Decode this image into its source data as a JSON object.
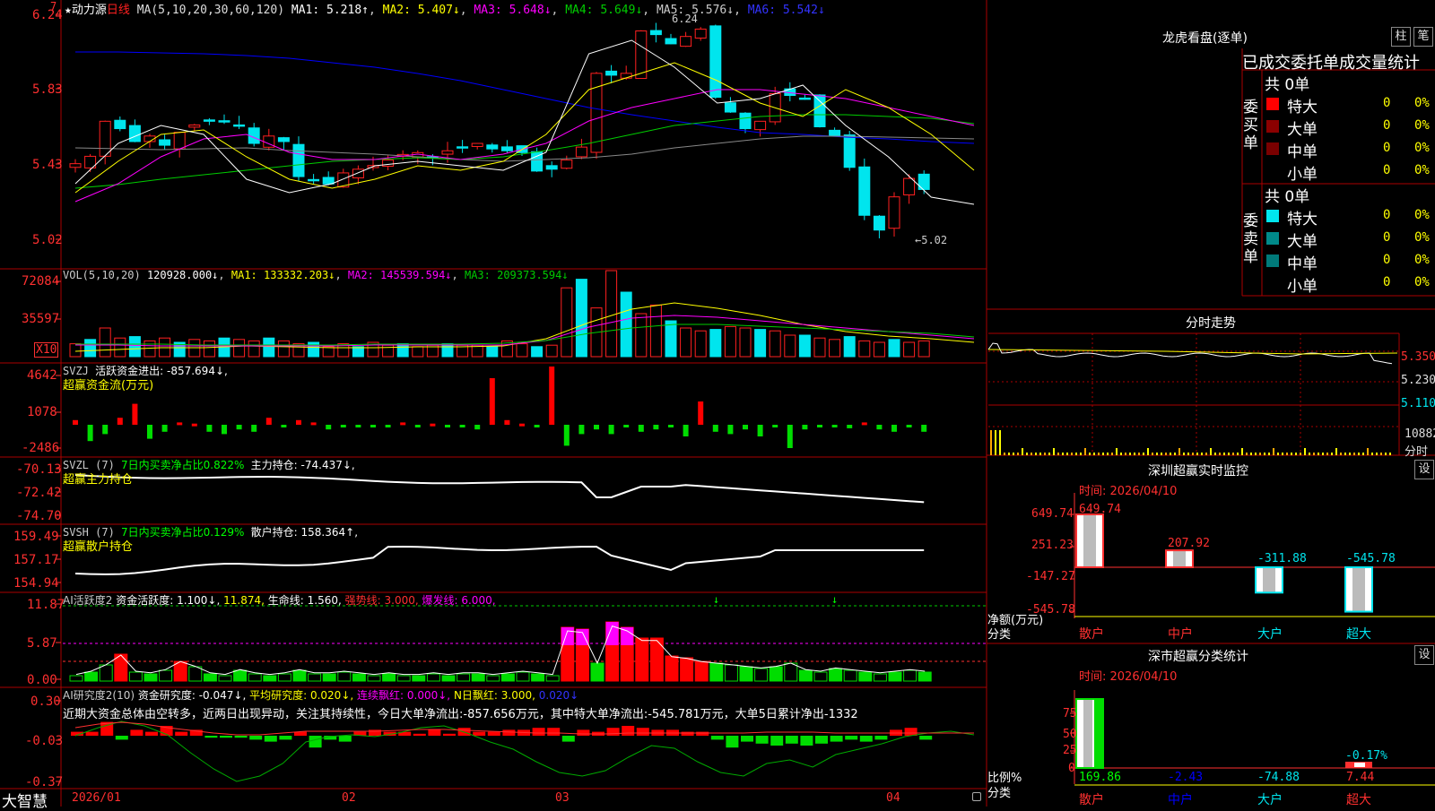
{
  "colors": {
    "up": "#ff2020",
    "down": "#00e5ee",
    "ma1": "#ffffff",
    "ma2": "#ffff00",
    "ma3": "#ff00ff",
    "ma4": "#00cc00",
    "ma5": "#888888",
    "ma6": "#0000ff",
    "grid": "#aa0000",
    "axis": "#ff3030"
  },
  "kline": {
    "star": "★",
    "name": "动力源",
    "period": "日线",
    "ma_label": "MA(5,10,20,30,60,120)",
    "ma": [
      {
        "label": "MA1:",
        "value": "5.218↑"
      },
      {
        "label": "MA2:",
        "value": "5.407↓"
      },
      {
        "label": "MA3:",
        "value": "5.648↓"
      },
      {
        "label": "MA4:",
        "value": "5.649↓"
      },
      {
        "label": "MA5:",
        "value": "5.576↓"
      },
      {
        "label": "MA6:",
        "value": "5.542↓"
      }
    ],
    "y_ticks": [
      "6.24",
      "5.83",
      "5.43",
      "5.02"
    ],
    "high_marker": "6.24",
    "low_marker": "←5.02",
    "top_left": "7"
  },
  "vol": {
    "title": "VOL(5,10,20)",
    "value": "120928.000↓",
    "ma1": "MA1: 133332.203↓",
    "ma2": "MA2: 145539.594↓",
    "ma3": "MA3: 209373.594↓",
    "y_ticks": [
      "72084",
      "35597"
    ],
    "unit": "X10"
  },
  "svzj": {
    "title": "SVZJ",
    "label": "活跃资金进出: -857.694↓,",
    "sub": "超赢资金流(万元)",
    "y_ticks": [
      "4642",
      "1078",
      "-2486"
    ]
  },
  "svzl": {
    "title": "SVZL (7)",
    "label1": "7日内买卖净占比0.822%",
    "label2": "主力持仓: -74.437↓,",
    "sub": "超赢主力持仓",
    "y_ticks": [
      "-70.13",
      "-72.42",
      "-74.70"
    ]
  },
  "svsh": {
    "title": "SVSH (7)",
    "label1": "7日内买卖净占比0.129%",
    "label2": "散户持仓: 158.364↑,",
    "sub": "超赢散户持仓",
    "y_ticks": [
      "159.49",
      "157.17",
      "154.94"
    ]
  },
  "ai1": {
    "title": "AI活跃度2",
    "l1": "资金活跃度: 1.100↓,",
    "l2": "11.874,",
    "l3": "生命线: 1.560,",
    "l4": "强势线: 3.000,",
    "l5": "爆发线: 6.000,",
    "y_ticks": [
      "11.87",
      "5.87",
      "0.00"
    ]
  },
  "ai2": {
    "title": "AI研究度2(10)",
    "l1": "资金研究度: -0.047↓,",
    "l2": "平均研究度: 0.020↓,",
    "l3": "连续飘红: 0.000↓,",
    "l4": "N日飘红: 3.000,",
    "l5": "0.020↓",
    "summary": "近期大资金总体由空转多，近两日出现异动，关注其持续性，今日大单净流出:-857.656万元，其中特大单净流出:-545.781万元，大单5日累计净出-1332",
    "y_ticks": [
      "0.30",
      "-0.03",
      "-0.37"
    ]
  },
  "x_axis": {
    "logo": "大智慧",
    "labels": [
      "2026/01",
      "02",
      "03",
      "04"
    ]
  },
  "dragon": {
    "title": "龙虎看盘(逐单)",
    "btn1": "柱",
    "btn2": "笔",
    "header": "已成交委托单成交量统计",
    "buy": {
      "side": "委买单",
      "total": "共 0单",
      "rows": [
        {
          "name": "特大",
          "n": "0",
          "pct": "0%"
        },
        {
          "name": "大单",
          "n": "0",
          "pct": "0%"
        },
        {
          "name": "中单",
          "n": "0",
          "pct": "0%"
        },
        {
          "name": "小单",
          "n": "0",
          "pct": "0%"
        }
      ]
    },
    "sell": {
      "side": "委卖单",
      "total": "共 0单",
      "rows": [
        {
          "name": "特大",
          "n": "0",
          "pct": "0%"
        },
        {
          "name": "大单",
          "n": "0",
          "pct": "0%"
        },
        {
          "name": "中单",
          "n": "0",
          "pct": "0%"
        },
        {
          "name": "小单",
          "n": "0",
          "pct": "0%"
        }
      ]
    }
  },
  "intraday": {
    "title": "分时走势",
    "prices": [
      "5.350",
      "5.230",
      "5.110"
    ],
    "vol": "10882",
    "vol_unit": "分时"
  },
  "monitor": {
    "title": "深圳超赢实时监控",
    "btn": "设",
    "time": "时间: 2026/04/10",
    "y_ticks": [
      "649.74",
      "251.23",
      "-147.27",
      "-545.78"
    ],
    "ylabel": "净额(万元)",
    "xlabel": "分类",
    "categories": [
      "散户",
      "中户",
      "大户",
      "超大"
    ],
    "values": [
      649.74,
      207.92,
      -311.88,
      -545.78
    ],
    "value_labels": [
      "649.74",
      "207.92",
      "-311.88",
      "-545.78"
    ]
  },
  "classify": {
    "title": "深市超赢分类统计",
    "btn": "设",
    "time": "时间: 2026/04/10",
    "y_ticks": [
      "75",
      "50",
      "25",
      "0"
    ],
    "ylabel": "比例%",
    "xlabel": "分类",
    "categories": [
      "散户",
      "中户",
      "大户",
      "超大"
    ],
    "bottom_labels": [
      "169.86",
      "-2.43",
      "-74.88",
      "7.44"
    ],
    "extra_label": "-0.17%"
  }
}
